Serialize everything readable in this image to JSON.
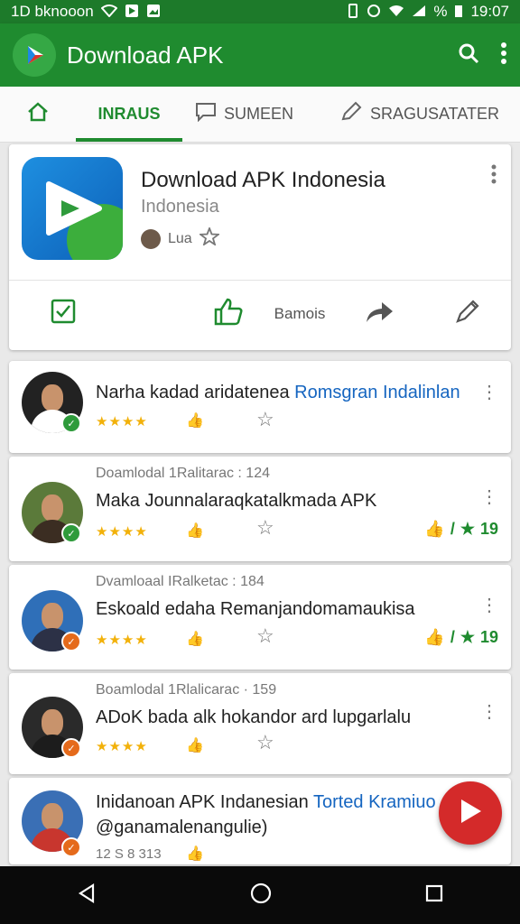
{
  "status_bar": {
    "left_text": "1D bknooon",
    "time": "19:07",
    "battery_text": "%",
    "left_icons": [
      "wifi-icon",
      "play-store-icon",
      "photo-icon"
    ],
    "right_icons": [
      "vibrate-icon",
      "alarm-icon",
      "wifi-icon",
      "signal-icon",
      "battery-icon"
    ]
  },
  "app_bar": {
    "title": "Download APK",
    "logo_icon": "play-logo-icon",
    "actions": [
      "search-icon",
      "more-vert-icon"
    ],
    "color": "#1f8b2f"
  },
  "tabs": [
    {
      "icon": "home-icon",
      "label": ""
    },
    {
      "icon": "",
      "label": "INRAUS",
      "active": true
    },
    {
      "icon": "comment-icon",
      "label": "SUMEEN"
    },
    {
      "icon": "edit-icon",
      "label": "SRAGUSATATER"
    }
  ],
  "app_card": {
    "name": "Download APK Indonesia",
    "developer": "Indonesia",
    "meta_label": "Lua",
    "actions": {
      "install_icon": "check-square-icon",
      "like_icon": "thumbs-up-icon",
      "rating_label": "Bamois",
      "share_icon": "share-icon",
      "edit_icon": "pen-icon"
    }
  },
  "reviews": [
    {
      "subtitle": "",
      "text": "Narha kadad aridatenea ",
      "text_accent": "Romsgran Indalinlan",
      "stars": 4,
      "score": "",
      "extra": "",
      "badge_color": "#2e9b3b"
    },
    {
      "subtitle": "Doamlodal 1Ralitarac : 124",
      "text": "Maka Jounnalaraqkatalkmada APK",
      "text_accent": "",
      "stars": 4,
      "score": "19",
      "extra": "",
      "badge_color": "#2e9b3b"
    },
    {
      "subtitle": "Dvamloaal IRalketac : 184",
      "text": "Eskoald edaha Remanjandomamaukisa",
      "text_accent": "",
      "stars": 4,
      "score": "19",
      "extra": "",
      "badge_color": "#e56a1b"
    },
    {
      "subtitle": "Boamlodal 1Rlalicarac · 159",
      "text": "ADoK bada alk hokandor ard lupgarlalu",
      "text_accent": "",
      "stars": 4,
      "score": "",
      "extra": "",
      "badge_color": "#e56a1b"
    },
    {
      "subtitle": "",
      "text": "Inidanoan APK Indanesian ",
      "text_accent": "Torted Kramiuo",
      "text2": "@ganamalenangulie)",
      "stars": 0,
      "score": "",
      "extra": "12 S 8 313",
      "badge_color": "#e56a1b"
    }
  ],
  "fab": {
    "icon": "play-icon",
    "color": "#d42a2a"
  },
  "nav_bar": {
    "icons": [
      "back-icon",
      "home-circle-icon",
      "recents-icon"
    ]
  }
}
